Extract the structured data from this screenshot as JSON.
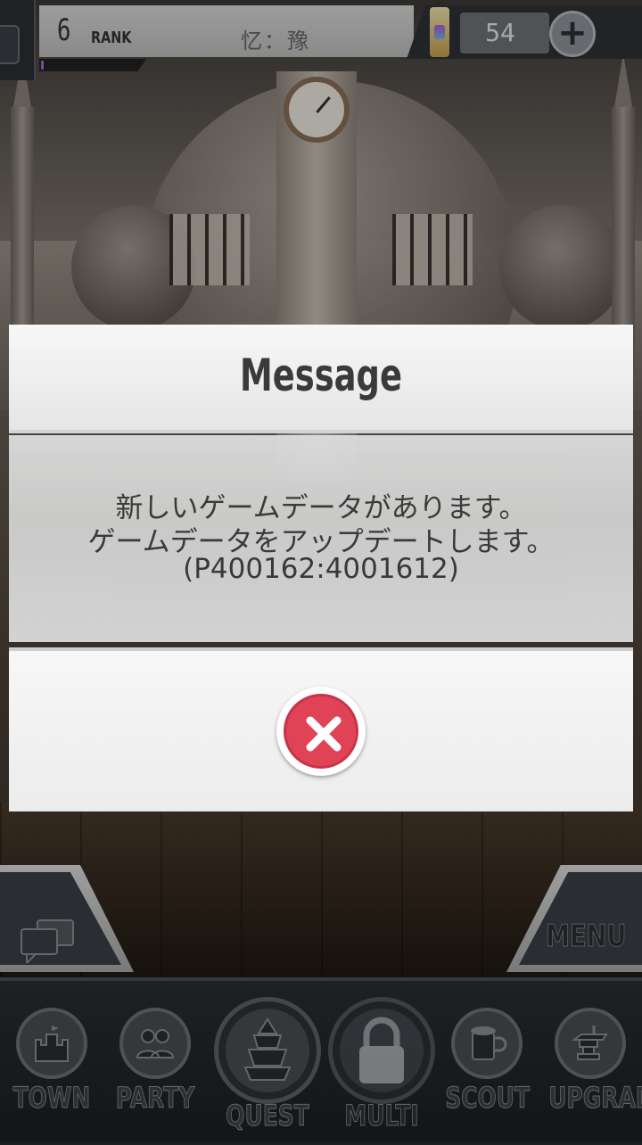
{
  "hud": {
    "rank_value": "6",
    "rank_label": "RANK",
    "player_name": "忆：豫",
    "exp_fraction": 0.03,
    "gem_count": "54",
    "add_gems_symbol": "+"
  },
  "dialog": {
    "title": "Message",
    "lines": [
      "新しいゲームデータがあります。",
      "ゲームデータをアップデートします。",
      "(P400162:4001612)"
    ],
    "close_icon": "close-x-icon",
    "close_color": "#e04356"
  },
  "side_tabs": {
    "chat_icon": "chat-bubbles-icon",
    "menu_label": "MENU"
  },
  "nav": {
    "items": [
      {
        "label": "TOWN",
        "icon": "castle-icon"
      },
      {
        "label": "PARTY",
        "icon": "people-icon"
      },
      {
        "label": "QUEST",
        "icon": "tower-icon"
      },
      {
        "label": "MULTI",
        "icon": "lock-icon",
        "locked": true
      },
      {
        "label": "SCOUT",
        "icon": "mug-icon"
      },
      {
        "label": "UPGRADE",
        "icon": "anvil-icon"
      }
    ]
  }
}
